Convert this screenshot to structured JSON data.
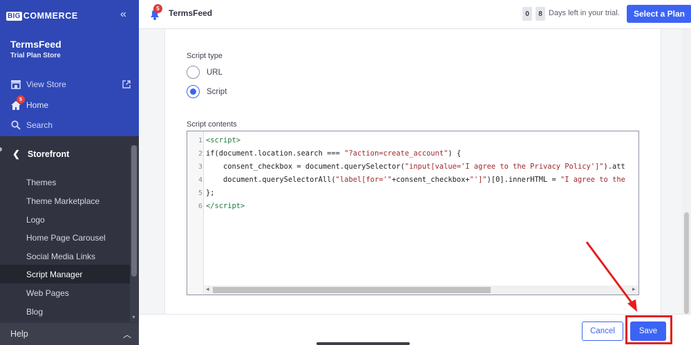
{
  "sidebar": {
    "logo_big": "BIG",
    "logo_rest": "COMMERCE",
    "collapse_icon": "double-chevron-left-icon",
    "store_name": "TermsFeed",
    "store_plan": "Trial Plan Store",
    "view_store": "View Store",
    "home": "Home",
    "home_badge": "5",
    "search": "Search",
    "storefront": "Storefront",
    "items": [
      {
        "label": "Themes"
      },
      {
        "label": "Theme Marketplace"
      },
      {
        "label": "Logo"
      },
      {
        "label": "Home Page Carousel"
      },
      {
        "label": "Social Media Links"
      },
      {
        "label": "Script Manager"
      },
      {
        "label": "Web Pages"
      },
      {
        "label": "Blog"
      }
    ],
    "active_item": "Script Manager",
    "help": "Help"
  },
  "topbar": {
    "notification_badge": "5",
    "store_name": "TermsFeed",
    "trial_digits": [
      "0",
      "8"
    ],
    "trial_text": "Days left in your trial.",
    "select_plan": "Select a Plan"
  },
  "form": {
    "script_type_label": "Script type",
    "options": [
      {
        "label": "URL",
        "checked": false
      },
      {
        "label": "Script",
        "checked": true
      }
    ],
    "script_contents_label": "Script contents",
    "line_numbers": [
      "1",
      "2",
      "3",
      "4",
      "5",
      "6"
    ]
  },
  "footer": {
    "cancel": "Cancel",
    "save": "Save"
  },
  "colors": {
    "brand_blue": "#3c64f4",
    "sidebar_top": "#2f48b6",
    "sidebar": "#313440",
    "annotation_red": "#e51e1e"
  }
}
